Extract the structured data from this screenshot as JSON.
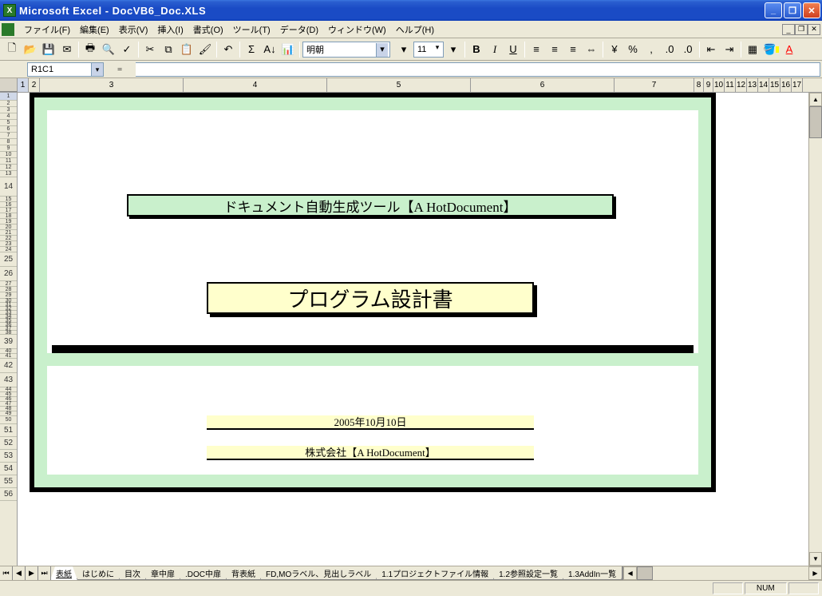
{
  "window": {
    "title": "Microsoft Excel - DocVB6_Doc.XLS"
  },
  "menu": {
    "file": "ファイル(F)",
    "edit": "編集(E)",
    "view": "表示(V)",
    "insert": "挿入(I)",
    "format": "書式(O)",
    "tools": "ツール(T)",
    "data": "データ(D)",
    "window": "ウィンドウ(W)",
    "help": "ヘルプ(H)"
  },
  "toolbar": {
    "font_name": "明朝",
    "font_size": "11"
  },
  "namebox": "R1C1",
  "formula": "",
  "columns": [
    "1",
    "2",
    "3",
    "4",
    "5",
    "6",
    "7",
    "8",
    "9",
    "10",
    "11",
    "12",
    "13",
    "14",
    "15",
    "16",
    "17"
  ],
  "rows_visible": [
    "1",
    "2",
    "3",
    "4",
    "5",
    "6",
    "7",
    "8",
    "9",
    "10",
    "11",
    "12",
    "13",
    "14",
    "15",
    "16",
    "17",
    "18",
    "19",
    "20",
    "21",
    "22",
    "23",
    "24",
    "25",
    "26",
    "27",
    "28",
    "29",
    "30",
    "31",
    "32",
    "33",
    "34",
    "35",
    "36",
    "37",
    "38",
    "39",
    "40",
    "41",
    "42",
    "43",
    "44",
    "45",
    "46",
    "47",
    "48",
    "49",
    "50",
    "51",
    "52",
    "53",
    "54",
    "55",
    "56"
  ],
  "columns_huge": [
    "3",
    "4",
    "5",
    "6",
    "7"
  ],
  "document": {
    "tool_title": "ドキュメント自動生成ツール【A HotDocument】",
    "doc_title": "プログラム設計書",
    "date": "2005年10月10日",
    "company": "株式会社【A HotDocument】"
  },
  "sheet_tabs": {
    "active": "表紙",
    "others": [
      "はじめに",
      "目次",
      "章中扉",
      ".DOC中扉",
      "背表紙",
      "FD,MOラベル、見出しラベル",
      "1.1プロジェクトファイル情報",
      "1.2参照設定一覧",
      "1.3AddIn一覧"
    ]
  },
  "status": {
    "num": "NUM"
  }
}
